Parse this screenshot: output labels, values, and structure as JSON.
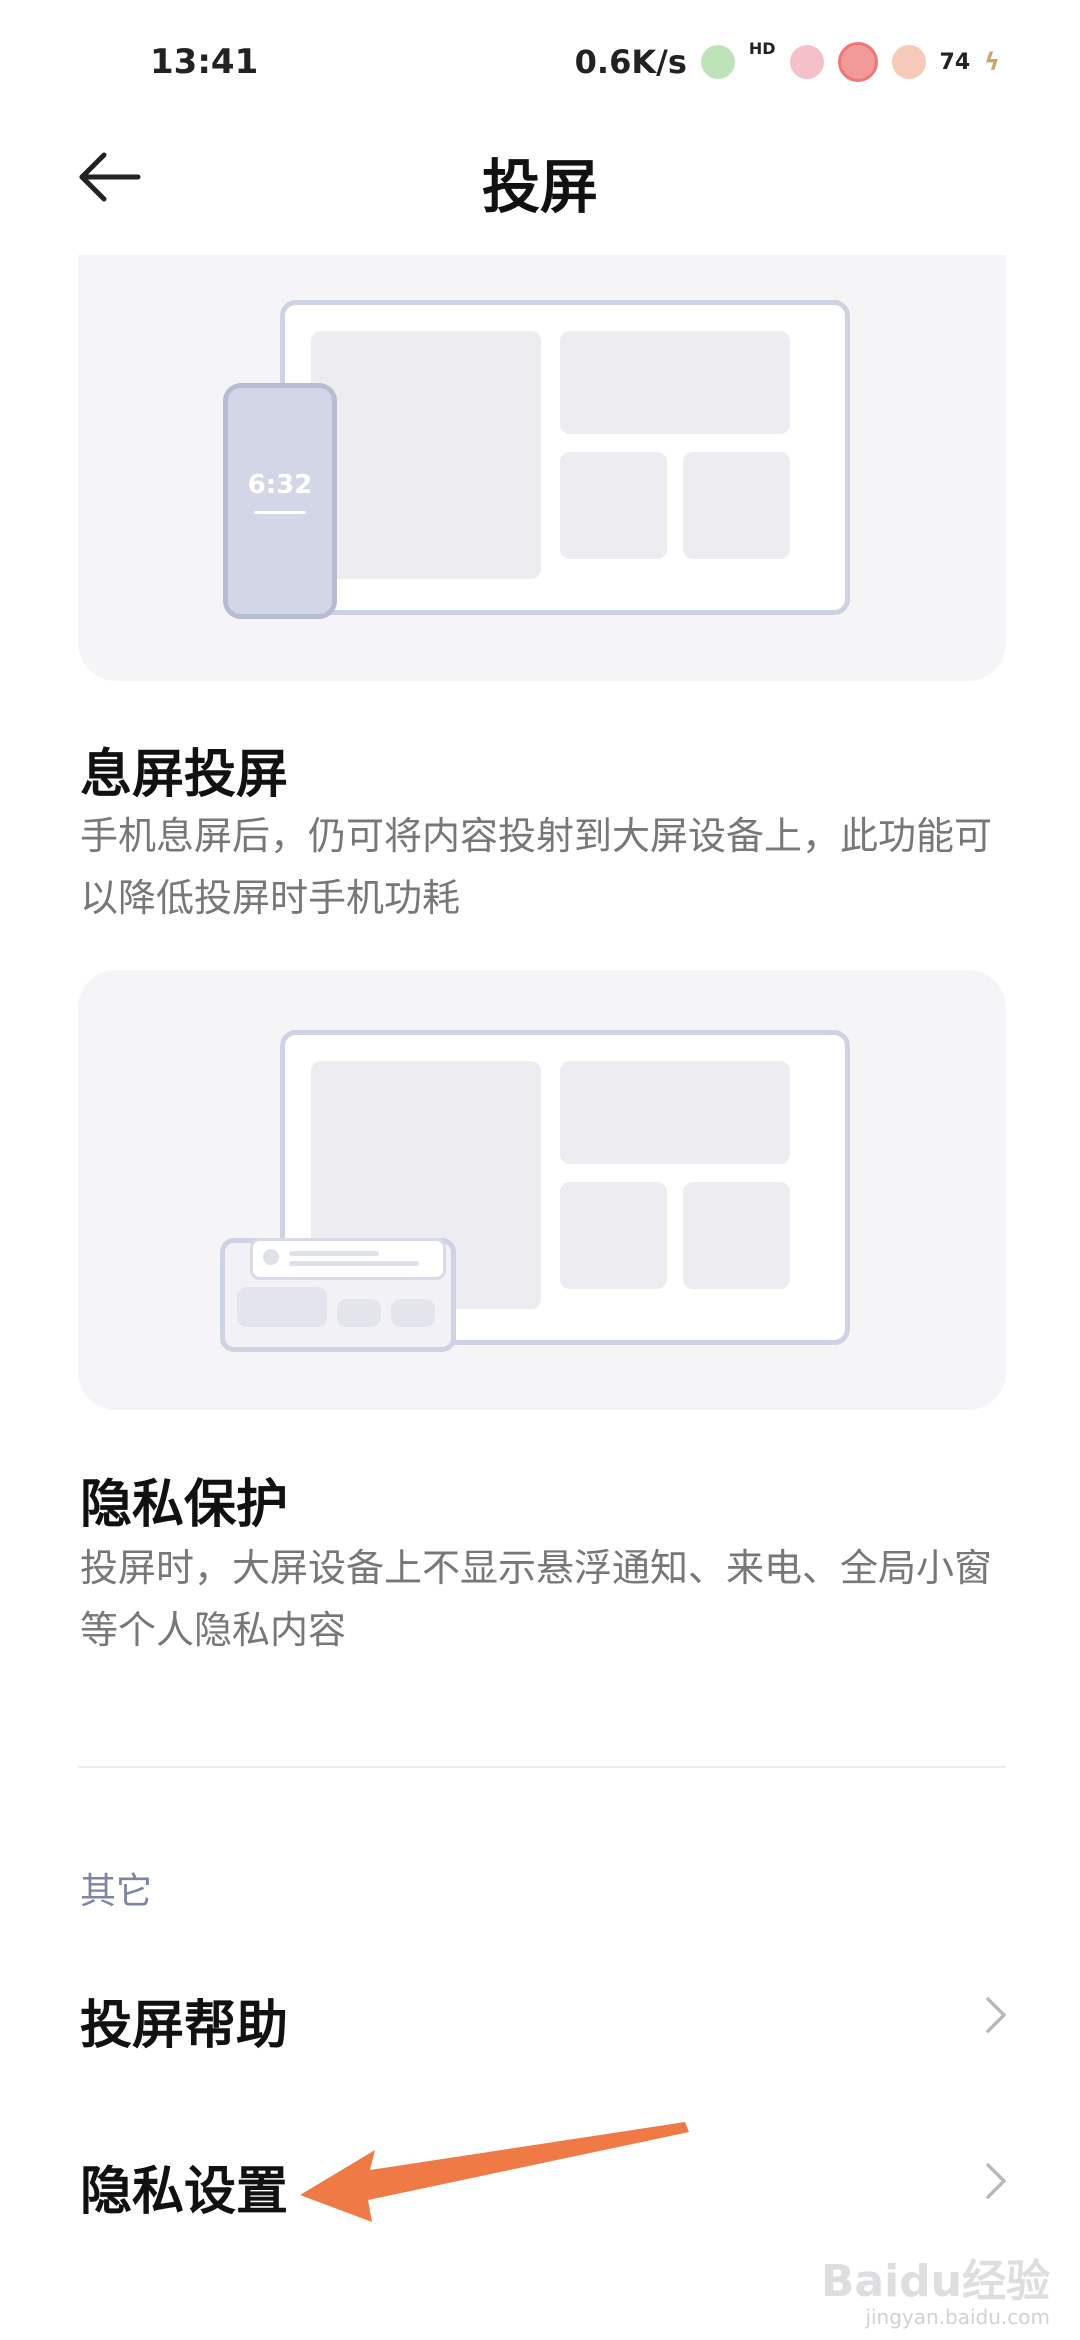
{
  "status_bar": {
    "time": "13:41",
    "net_speed": "0.6K/s",
    "hd_label": "HD",
    "battery": "74"
  },
  "header": {
    "back_icon": "arrow-left-icon",
    "title": "投屏"
  },
  "illustration1": {
    "phone_time": "6:32"
  },
  "section1": {
    "title": "息屏投屏",
    "description": "手机息屏后，仍可将内容投射到大屏设备上，此功能可以降低投屏时手机功耗"
  },
  "section2": {
    "title": "隐私保护",
    "description": "投屏时，大屏设备上不显示悬浮通知、来电、全局小窗等个人隐私内容"
  },
  "other_group": {
    "label": "其它",
    "items": [
      {
        "label": "投屏帮助",
        "icon": "chevron-right-icon"
      },
      {
        "label": "隐私设置",
        "icon": "chevron-right-icon"
      }
    ]
  },
  "annotation": {
    "arrow_color": "#f07a45"
  },
  "watermark": {
    "text": "Baidu经验",
    "sub": "jingyan.baidu.com"
  }
}
